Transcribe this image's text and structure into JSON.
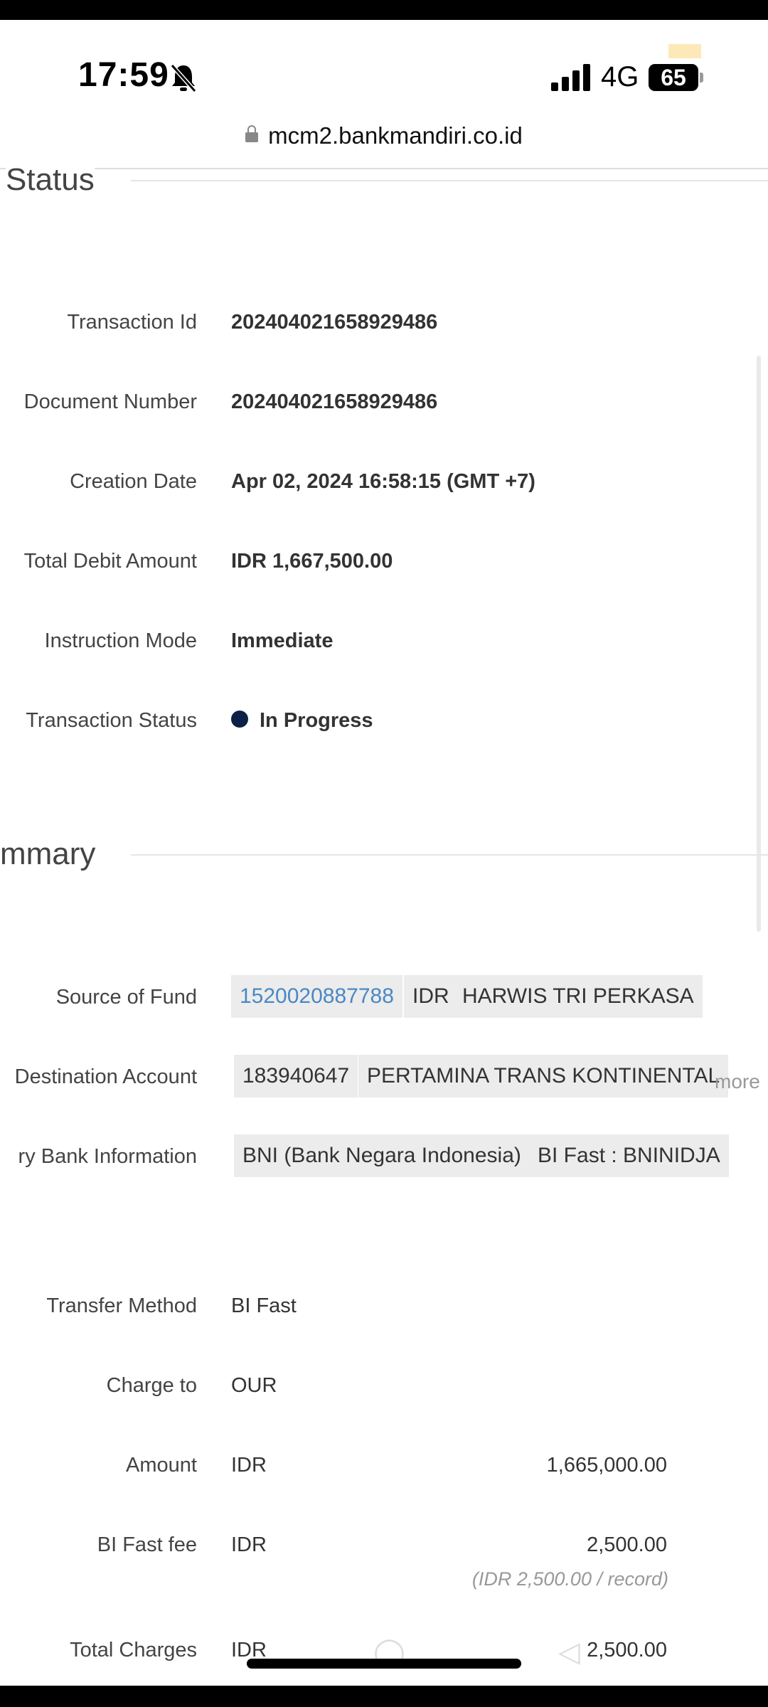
{
  "status_bar": {
    "time": "17:59",
    "network": "4G",
    "battery": "65"
  },
  "browser": {
    "url": "mcm2.bankmandiri.co.id"
  },
  "status_section": {
    "title": "Status",
    "rows": [
      {
        "label": "Transaction Id",
        "value": "202404021658929486"
      },
      {
        "label": "Document Number",
        "value": "202404021658929486"
      },
      {
        "label": "Creation Date",
        "value": "Apr 02, 2024 16:58:15 (GMT +7)"
      },
      {
        "label": "Total Debit Amount",
        "value": "IDR 1,667,500.00"
      },
      {
        "label": "Instruction Mode",
        "value": "Immediate"
      },
      {
        "label": "Transaction Status",
        "value": "In Progress",
        "status_color": "#0b2147"
      }
    ]
  },
  "summary_section": {
    "title": "mmary",
    "source_of_fund": {
      "label": "Source of Fund",
      "account": "1520020887788",
      "currency": "IDR",
      "name": "HARWIS TRI PERKASA"
    },
    "destination_account": {
      "label": "Destination Account",
      "account": "183940647",
      "name": "PERTAMINA TRANS KONTINENTAL",
      "more": "more"
    },
    "beneficiary_bank": {
      "label": "ry Bank Information",
      "bank": "BNI (Bank Negara Indonesia)",
      "code": "BI Fast : BNINIDJA"
    },
    "transfer_method": {
      "label": "Transfer Method",
      "value": "BI Fast"
    },
    "charge_to": {
      "label": "Charge to",
      "value": "OUR"
    },
    "amount": {
      "label": "Amount",
      "currency": "IDR",
      "value": "1,665,000.00"
    },
    "bi_fast_fee": {
      "label": "BI Fast fee",
      "currency": "IDR",
      "value": "2,500.00",
      "note": "(IDR 2,500.00 / record)"
    },
    "total_charges": {
      "label": "Total Charges",
      "currency": "IDR",
      "value": "2,500.00"
    }
  }
}
